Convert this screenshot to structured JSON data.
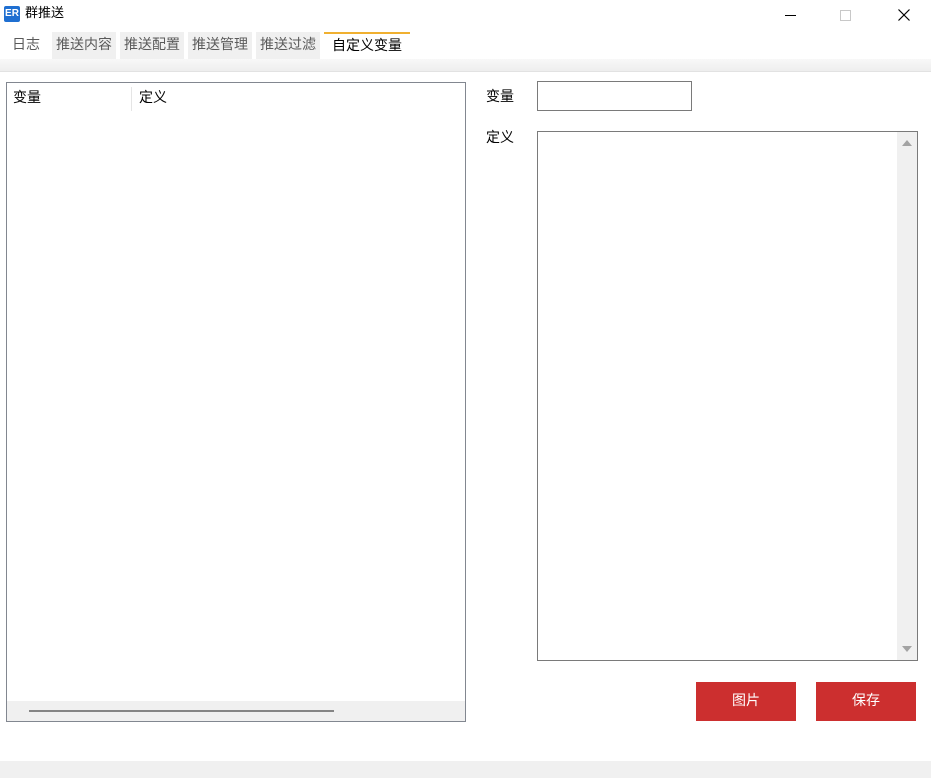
{
  "window": {
    "title": "群推送",
    "icon": "app-logo-icon",
    "icon_text": "ER",
    "controls": {
      "minimize": "minimize-icon",
      "maximize": "maximize-icon",
      "close_glyph": "✕"
    }
  },
  "tabs": [
    {
      "label": "日志",
      "active": false
    },
    {
      "label": "推送内容",
      "active": false
    },
    {
      "label": "推送配置",
      "active": false
    },
    {
      "label": "推送管理",
      "active": false
    },
    {
      "label": "推送过滤",
      "active": false
    },
    {
      "label": "自定义变量",
      "active": true
    }
  ],
  "accent_color": "#f0b030",
  "list": {
    "columns": [
      "变量",
      "定义"
    ],
    "rows": []
  },
  "form": {
    "variable_label": "变量",
    "variable_value": "",
    "definition_label": "定义",
    "definition_value": ""
  },
  "buttons": {
    "image_label": "图片",
    "save_label": "保存",
    "color": "#cc2f2f"
  }
}
